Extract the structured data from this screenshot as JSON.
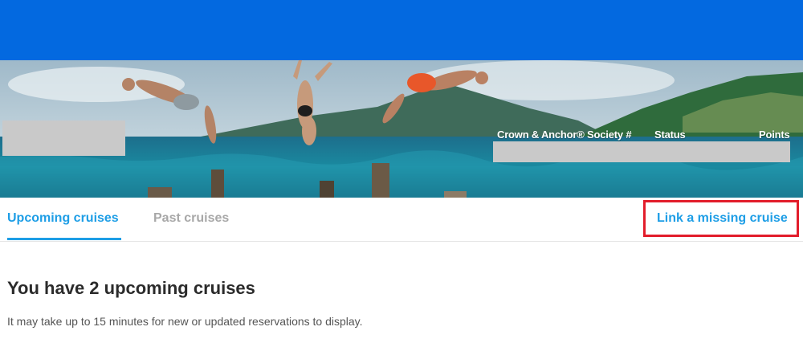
{
  "hero": {
    "labels": {
      "membership": "Crown & Anchor® Society #",
      "status": "Status",
      "points": "Points"
    }
  },
  "tabs": {
    "upcoming": "Upcoming cruises",
    "past": "Past cruises",
    "active": "upcoming"
  },
  "actions": {
    "link_missing": "Link a missing cruise"
  },
  "summary": {
    "heading": "You have 2 upcoming cruises",
    "note": "It may take up to 15 minutes for new or updated reservations to display."
  },
  "colors": {
    "top_bar": "#0369e0",
    "accent": "#1e9ee6",
    "highlight_box": "#e21d2b"
  }
}
